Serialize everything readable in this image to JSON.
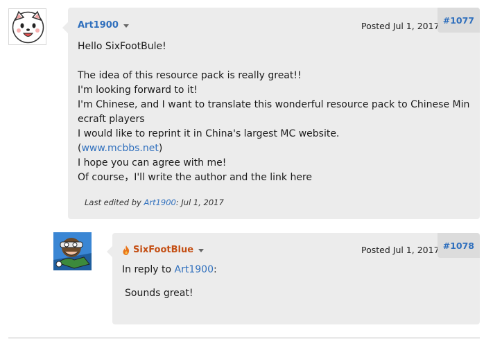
{
  "post1": {
    "author": "Art1900",
    "posted": "Posted Jul 1, 2017",
    "number": "#1077",
    "lines": [
      "Hello SixFootBule!",
      "",
      "The idea of this resource pack is really great!!",
      "I'm looking forward to it!",
      "I'm Chinese, and I want to translate this wonderful resource pack to Chinese Minecraft players",
      "I would like to reprint it in China's largest MC website."
    ],
    "link_open": "(",
    "link": "www.mcbbs.net",
    "link_close": ")",
    "lines_after": [
      "I hope you can agree with me!",
      "Of course，I'll write the author and the link here"
    ],
    "edited_prefix": "Last edited by ",
    "edited_user": "Art1900",
    "edited_suffix": ": Jul 1, 2017"
  },
  "post2": {
    "author": "SixFootBlue",
    "posted": "Posted Jul 1, 2017",
    "number": "#1078",
    "reply_prefix": "In reply to ",
    "reply_user": "Art1900",
    "reply_suffix": ":",
    "body": "Sounds great!"
  },
  "colors": {
    "link": "#2f6fbd",
    "author2": "#c44f14",
    "bubble": "#ececec"
  }
}
